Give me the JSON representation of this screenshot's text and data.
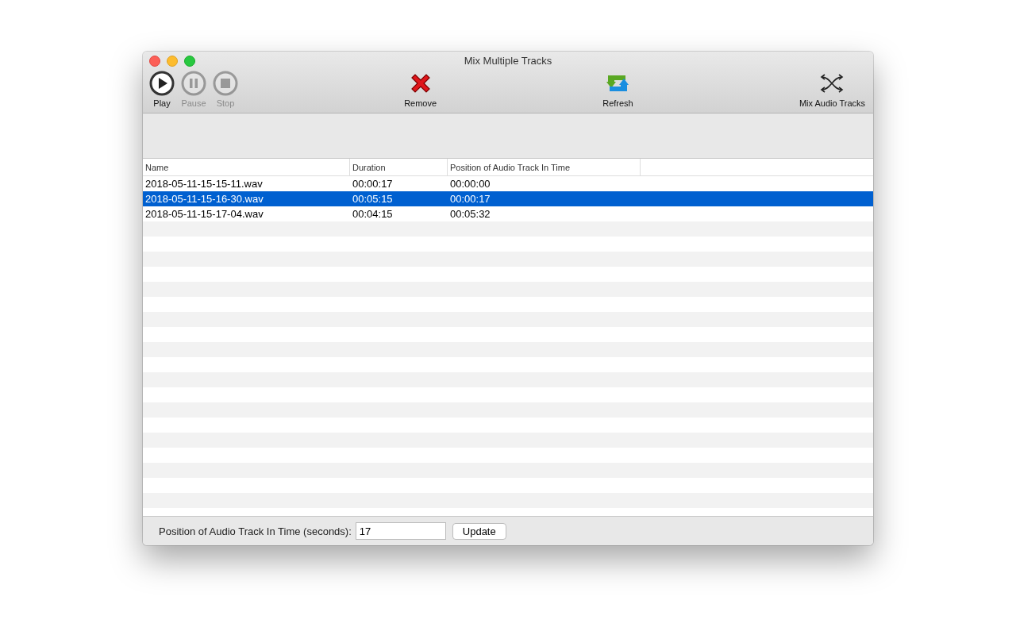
{
  "window": {
    "title": "Mix Multiple Tracks"
  },
  "toolbar": [
    {
      "kind": "play",
      "label": "Play",
      "disabled": false
    },
    {
      "kind": "pause",
      "label": "Pause",
      "disabled": true
    },
    {
      "kind": "stop",
      "label": "Stop",
      "disabled": true
    },
    {
      "kind": "remove",
      "label": "Remove",
      "disabled": false
    },
    {
      "kind": "refresh",
      "label": "Refresh",
      "disabled": false
    },
    {
      "kind": "mix",
      "label": "Mix Audio Tracks",
      "disabled": false
    }
  ],
  "table": {
    "columns": [
      "Name",
      "Duration",
      "Position of Audio Track In Time"
    ],
    "rows": [
      {
        "cells": [
          "2018-05-11-15-15-11.wav",
          "00:00:17",
          "00:00:00"
        ],
        "selected": false
      },
      {
        "cells": [
          "2018-05-11-15-16-30.wav",
          "00:05:15",
          "00:00:17"
        ],
        "selected": true
      },
      {
        "cells": [
          "2018-05-11-15-17-04.wav",
          "00:04:15",
          "00:05:32"
        ],
        "selected": false
      }
    ]
  },
  "footer": {
    "label": "Position of Audio Track In Time (seconds):",
    "value": "17",
    "button": "Update"
  }
}
